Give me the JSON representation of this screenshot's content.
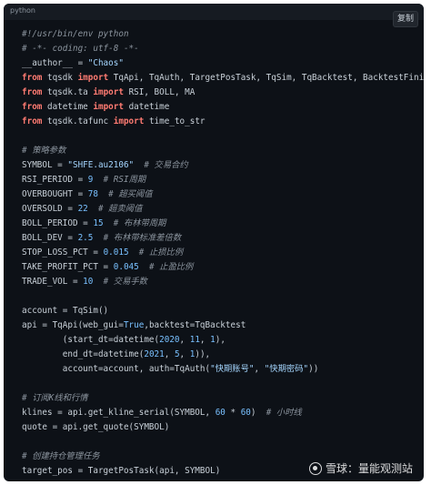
{
  "language": "python",
  "copy_label": "复制",
  "watermark": "雪球：量能观测站",
  "lines": [
    [
      [
        "cm",
        "#!/usr/bin/env python"
      ]
    ],
    [
      [
        "cm",
        "# -*- coding: utf-8 -*-"
      ]
    ],
    [
      [
        "",
        "__author__ = "
      ],
      [
        "st",
        "\"Chaos\""
      ]
    ],
    [
      [
        "kw",
        "from"
      ],
      [
        "",
        " tqsdk "
      ],
      [
        "kw",
        "import"
      ],
      [
        "",
        " TqApi, TqAuth, TargetPosTask, TqSim, TqBacktest, BacktestFinished"
      ]
    ],
    [
      [
        "kw",
        "from"
      ],
      [
        "",
        " tqsdk.ta "
      ],
      [
        "kw",
        "import"
      ],
      [
        "",
        " RSI, BOLL, MA"
      ]
    ],
    [
      [
        "kw",
        "from"
      ],
      [
        "",
        " datetime "
      ],
      [
        "kw",
        "import"
      ],
      [
        "",
        " datetime"
      ]
    ],
    [
      [
        "kw",
        "from"
      ],
      [
        "",
        " tqsdk.tafunc "
      ],
      [
        "kw",
        "import"
      ],
      [
        "",
        " time_to_str"
      ]
    ],
    [],
    [
      [
        "cm",
        "# 策略参数"
      ]
    ],
    [
      [
        "",
        "SYMBOL = "
      ],
      [
        "st",
        "\"SHFE.au2106\""
      ],
      [
        "",
        "  "
      ],
      [
        "cm",
        "# 交易合约"
      ]
    ],
    [
      [
        "",
        "RSI_PERIOD = "
      ],
      [
        "nm",
        "9"
      ],
      [
        "",
        "  "
      ],
      [
        "cm",
        "# RSI周期"
      ]
    ],
    [
      [
        "",
        "OVERBOUGHT = "
      ],
      [
        "nm",
        "78"
      ],
      [
        "",
        "  "
      ],
      [
        "cm",
        "# 超买阈值"
      ]
    ],
    [
      [
        "",
        "OVERSOLD = "
      ],
      [
        "nm",
        "22"
      ],
      [
        "",
        "  "
      ],
      [
        "cm",
        "# 超卖阈值"
      ]
    ],
    [
      [
        "",
        "BOLL_PERIOD = "
      ],
      [
        "nm",
        "15"
      ],
      [
        "",
        "  "
      ],
      [
        "cm",
        "# 布林带周期"
      ]
    ],
    [
      [
        "",
        "BOLL_DEV = "
      ],
      [
        "nm",
        "2.5"
      ],
      [
        "",
        "  "
      ],
      [
        "cm",
        "# 布林带标准差倍数"
      ]
    ],
    [
      [
        "",
        "STOP_LOSS_PCT = "
      ],
      [
        "nm",
        "0.015"
      ],
      [
        "",
        "  "
      ],
      [
        "cm",
        "# 止损比例"
      ]
    ],
    [
      [
        "",
        "TAKE_PROFIT_PCT = "
      ],
      [
        "nm",
        "0.045"
      ],
      [
        "",
        "  "
      ],
      [
        "cm",
        "# 止盈比例"
      ]
    ],
    [
      [
        "",
        "TRADE_VOL = "
      ],
      [
        "nm",
        "10"
      ],
      [
        "",
        "  "
      ],
      [
        "cm",
        "# 交易手数"
      ]
    ],
    [],
    [
      [
        "",
        "account = TqSim()"
      ]
    ],
    [
      [
        "",
        "api = TqApi(web_gui="
      ],
      [
        "bi",
        "True"
      ],
      [
        "",
        ",backtest=TqBacktest"
      ]
    ],
    [
      [
        "",
        "        (start_dt=datetime("
      ],
      [
        "nm",
        "2020"
      ],
      [
        "",
        ", "
      ],
      [
        "nm",
        "11"
      ],
      [
        "",
        ", "
      ],
      [
        "nm",
        "1"
      ],
      [
        "",
        "),"
      ]
    ],
    [
      [
        "",
        "        end_dt=datetime("
      ],
      [
        "nm",
        "2021"
      ],
      [
        "",
        ", "
      ],
      [
        "nm",
        "5"
      ],
      [
        "",
        ", "
      ],
      [
        "nm",
        "1"
      ],
      [
        "",
        ")),"
      ]
    ],
    [
      [
        "",
        "        account=account, auth=TqAuth("
      ],
      [
        "st",
        "\"快期账号\""
      ],
      [
        "",
        ", "
      ],
      [
        "st",
        "\"快期密码\""
      ],
      [
        "",
        "))"
      ]
    ],
    [],
    [
      [
        "cm",
        "# 订阅K线和行情"
      ]
    ],
    [
      [
        "",
        "klines = api.get_kline_serial(SYMBOL, "
      ],
      [
        "nm",
        "60"
      ],
      [
        "",
        " * "
      ],
      [
        "nm",
        "60"
      ],
      [
        "",
        ")  "
      ],
      [
        "cm",
        "# 小时线"
      ]
    ],
    [
      [
        "",
        "quote = api.get_quote(SYMBOL)"
      ]
    ],
    [],
    [
      [
        "cm",
        "# 创建持仓管理任务"
      ]
    ],
    [
      [
        "",
        "target_pos = TargetPosTask(api, SYMBOL)"
      ]
    ]
  ]
}
